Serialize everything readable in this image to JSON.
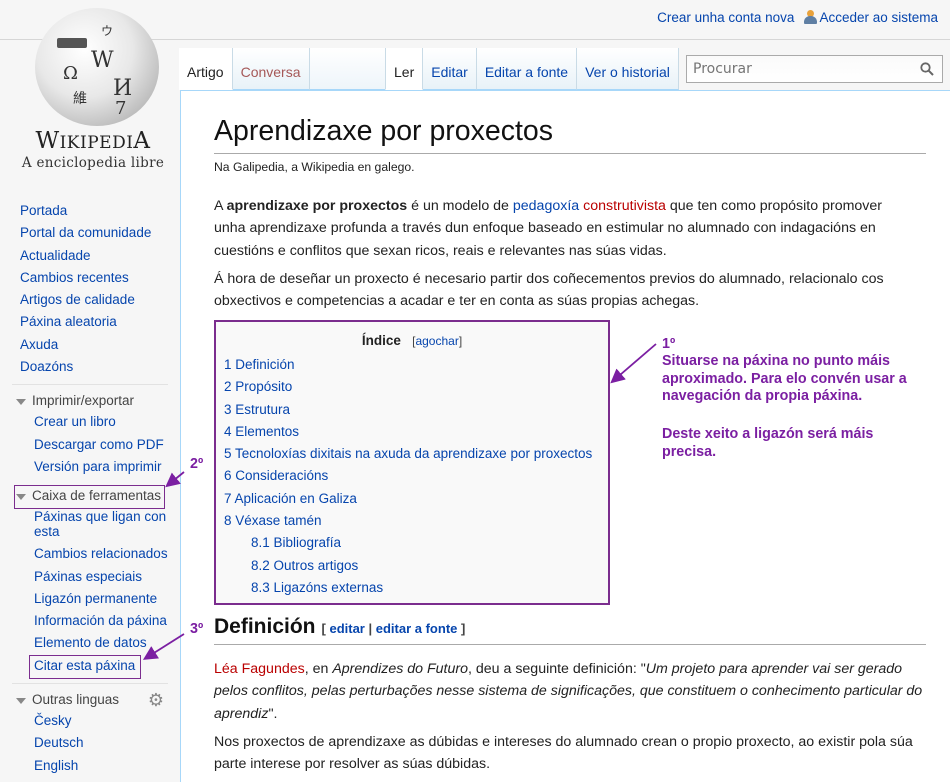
{
  "personal": {
    "create_account": "Crear unha conta nova",
    "login": "Acceder ao sistema"
  },
  "logo": {
    "wordmark_first": "W",
    "wordmark_mid": "IKIPEDI",
    "wordmark_last": "A",
    "tagline": "A enciclopedia libre",
    "glyphs": [
      "W",
      "Ω",
      "И",
      "維",
      "7",
      "ウ"
    ]
  },
  "sidebar": {
    "main": [
      {
        "label": "Portada"
      },
      {
        "label": "Portal da comunidade"
      },
      {
        "label": "Actualidade"
      },
      {
        "label": "Cambios recentes"
      },
      {
        "label": "Artigos de calidade"
      },
      {
        "label": "Páxina aleatoria"
      },
      {
        "label": "Axuda"
      },
      {
        "label": "Doazóns"
      }
    ],
    "print": {
      "heading": "Imprimir/exportar",
      "items": [
        {
          "label": "Crear un libro"
        },
        {
          "label": "Descargar como PDF"
        },
        {
          "label": "Versión para imprimir"
        }
      ]
    },
    "tools": {
      "heading": "Caixa de ferramentas",
      "items": [
        {
          "label": "Páxinas que ligan con esta"
        },
        {
          "label": "Cambios relacionados"
        },
        {
          "label": "Páxinas especiais"
        },
        {
          "label": "Ligazón permanente"
        },
        {
          "label": "Información da páxina"
        },
        {
          "label": "Elemento de datos"
        },
        {
          "label": "Citar esta páxina"
        }
      ]
    },
    "languages": {
      "heading": "Outras linguas",
      "items": [
        {
          "label": "Česky"
        },
        {
          "label": "Deutsch"
        },
        {
          "label": "English"
        }
      ]
    }
  },
  "tabs": {
    "left": [
      {
        "label": "Artigo",
        "selected": true
      },
      {
        "label": "Conversa",
        "selected": false
      }
    ],
    "right": [
      {
        "label": "Ler",
        "selected": true
      },
      {
        "label": "Editar",
        "selected": false
      },
      {
        "label": "Editar a fonte",
        "selected": false
      },
      {
        "label": "Ver o historial",
        "selected": false
      }
    ]
  },
  "search": {
    "placeholder": "Procurar"
  },
  "article": {
    "title": "Aprendizaxe por proxectos",
    "subtitle": "Na Galipedia, a Wikipedia en galego.",
    "intro": {
      "p1_a": "A ",
      "p1_bold": "aprendizaxe por proxectos",
      "p1_b": " é un modelo de ",
      "p1_link1": "pedagoxía",
      "p1_space": " ",
      "p1_link2": "construtivista",
      "p1_c": " que ten como propósito promover unha aprendizaxe profunda a través dun enfoque baseado en estimular no alumnado con indagacións en cuestións e conflitos que sexan ricos, reais e relevantes nas súas vidas.",
      "p2": "Á hora de deseñar un proxecto é necesario partir dos coñecementos previos do alumnado, relacionalo cos obxectivos e competencias a acadar e ter en conta as súas propias achegas."
    },
    "toc": {
      "title": "Índice",
      "bracket_open": "[",
      "toggle": "agochar",
      "bracket_close": "]",
      "items": [
        {
          "label": "1 Definición",
          "level": 1
        },
        {
          "label": "2 Propósito",
          "level": 1
        },
        {
          "label": "3 Estrutura",
          "level": 1
        },
        {
          "label": "4 Elementos",
          "level": 1
        },
        {
          "label": "5 Tecnoloxías dixitais na axuda da aprendizaxe por proxectos",
          "level": 1
        },
        {
          "label": "6 Consideracións",
          "level": 1
        },
        {
          "label": "7 Aplicación en Galiza",
          "level": 1
        },
        {
          "label": "8 Véxase tamén",
          "level": 1
        },
        {
          "label": "8.1 Bibliografía",
          "level": 2
        },
        {
          "label": "8.2 Outros artigos",
          "level": 2
        },
        {
          "label": "8.3 Ligazóns externas",
          "level": 2
        }
      ]
    },
    "section1": {
      "heading": "Definición",
      "edit_open": "[ ",
      "edit": "editar",
      "sep": " | ",
      "edit_source": "editar a fonte",
      "edit_close": " ]",
      "p1_link": "Léa Fagundes",
      "p1_a": ", en ",
      "p1_em": "Aprendizes do Futuro",
      "p1_b": ", deu a seguinte definición: \"",
      "p1_quote": "Um projeto para aprender vai ser gerado pelos conflitos, pelas perturbações nesse sistema de significações, que constituem o conhecimento particular do aprendiz",
      "p1_c": "\".",
      "p2": "Nos proxectos de aprendizaxe as dúbidas e intereses do alumnado crean o propio proxecto, ao existir pola súa parte interese por resolver as súas dúbidas."
    }
  },
  "annotations": {
    "step1_label": "1º",
    "step1_text": "Situarse na páxina no punto máis aproximado. Para elo convén usar a navegación da propia páxina.",
    "step1_note": "Deste xeito a ligazón será máis precisa.",
    "step2_label": "2º",
    "step3_label": "3º",
    "color": "#7b1fa2"
  },
  "colors": {
    "link": "#0645ad",
    "new_link": "#ba0000",
    "annotation_border": "#7b2d8e"
  }
}
